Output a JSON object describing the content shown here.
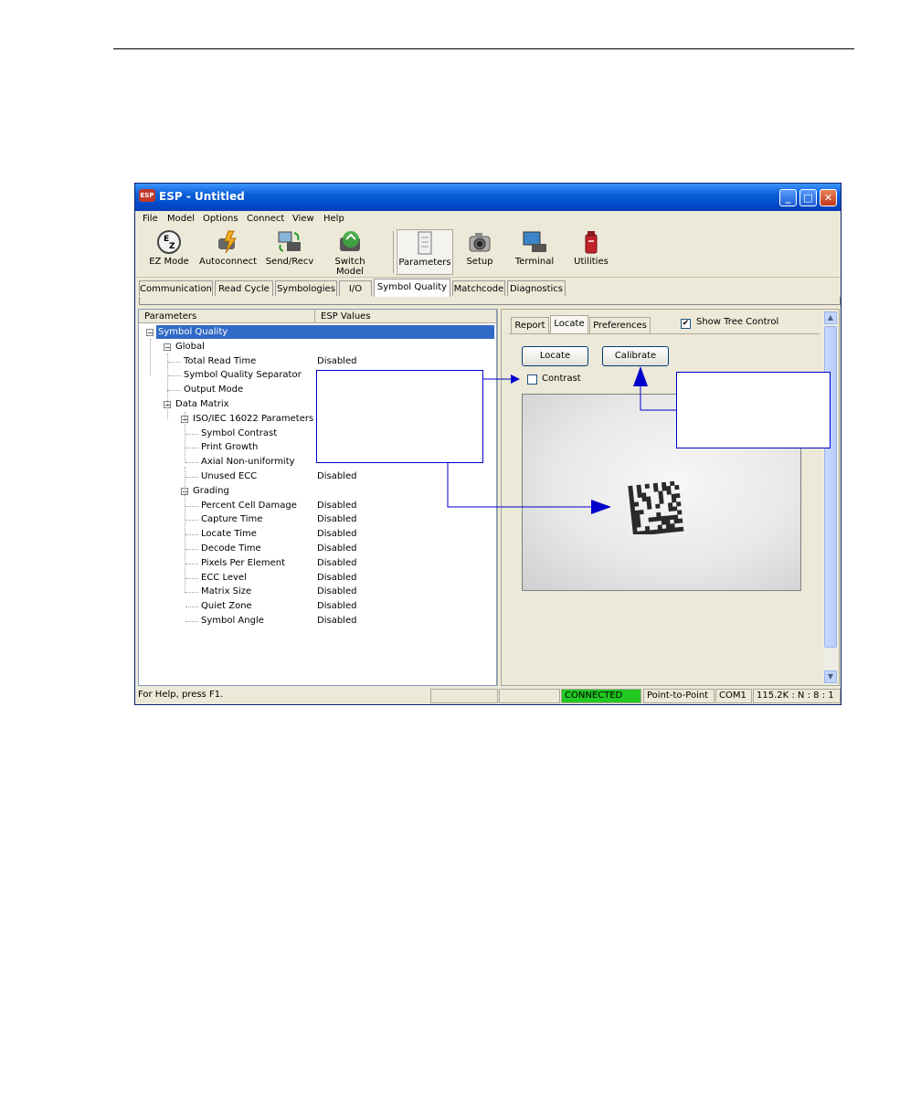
{
  "window": {
    "title": "ESP - Untitled",
    "icon_text": "ESP",
    "buttons": [
      "minimize-icon",
      "maximize-icon",
      "close-icon"
    ]
  },
  "menu": [
    "File",
    "Model",
    "Options",
    "Connect",
    "View",
    "Help"
  ],
  "toolbar": [
    {
      "label": "EZ Mode",
      "icon": "ez-mode-icon"
    },
    {
      "label": "Autoconnect",
      "icon": "autoconnect-icon"
    },
    {
      "label": "Send/Recv",
      "icon": "send-recv-icon"
    },
    {
      "label": "Switch Model",
      "icon": "switch-model-icon"
    },
    {
      "label": "Parameters",
      "icon": "parameters-icon",
      "active": true
    },
    {
      "label": "Setup",
      "icon": "camera-setup-icon"
    },
    {
      "label": "Terminal",
      "icon": "terminal-icon"
    },
    {
      "label": "Utilities",
      "icon": "utilities-icon"
    }
  ],
  "tabs": [
    "Communication",
    "Read Cycle",
    "Symbologies",
    "I/O",
    "Symbol Quality",
    "Matchcode",
    "Diagnostics"
  ],
  "active_tab": "Symbol Quality",
  "tree": {
    "columns": [
      "Parameters",
      "ESP Values"
    ],
    "rows": [
      {
        "label": "Symbol Quality",
        "value": "",
        "level": 0,
        "expander": "−",
        "selected": true
      },
      {
        "label": "Global",
        "value": "",
        "level": 1,
        "expander": "−"
      },
      {
        "label": "Total Read Time",
        "value": "Disabled",
        "level": 2
      },
      {
        "label": "Symbol Quality Separator",
        "value": "",
        "level": 2
      },
      {
        "label": "Output Mode",
        "value": "",
        "level": 2
      },
      {
        "label": "Data Matrix",
        "value": "",
        "level": 1,
        "expander": "−"
      },
      {
        "label": "ISO/IEC 16022 Parameters",
        "value": "",
        "level": 2,
        "expander": "−"
      },
      {
        "label": "Symbol Contrast",
        "value": "",
        "level": 3
      },
      {
        "label": "Print Growth",
        "value": "",
        "level": 3
      },
      {
        "label": "Axial Non-uniformity",
        "value": "",
        "level": 3
      },
      {
        "label": "Unused ECC",
        "value": "Disabled",
        "level": 3
      },
      {
        "label": "Grading",
        "value": "",
        "level": 2,
        "expander": "−"
      },
      {
        "label": "Percent Cell Damage",
        "value": "Disabled",
        "level": 3
      },
      {
        "label": "Capture Time",
        "value": "Disabled",
        "level": 3
      },
      {
        "label": "Locate Time",
        "value": "Disabled",
        "level": 3
      },
      {
        "label": "Decode Time",
        "value": "Disabled",
        "level": 3
      },
      {
        "label": "Pixels Per Element",
        "value": "Disabled",
        "level": 3
      },
      {
        "label": "ECC Level",
        "value": "Disabled",
        "level": 3
      },
      {
        "label": "Matrix Size",
        "value": "Disabled",
        "level": 3
      },
      {
        "label": "Quiet Zone",
        "value": "Disabled",
        "level": 3
      },
      {
        "label": "Symbol Angle",
        "value": "Disabled",
        "level": 3
      }
    ]
  },
  "right_panel": {
    "subtabs": [
      "Report",
      "Locate",
      "Preferences"
    ],
    "active_subtab": "Locate",
    "show_tree_control_label": "Show Tree Control",
    "show_tree_control_checked": true,
    "locate_button": "Locate",
    "calibrate_button": "Calibrate",
    "contrast_label": "Contrast",
    "contrast_checked": false
  },
  "status": {
    "help": "For Help, press F1.",
    "connection": "CONNECTED",
    "mode": "Point-to-Point",
    "port": "COM1",
    "settings": "115.2K : N : 8 : 1",
    "connected_color": "#21c821"
  },
  "annotation_color": "#0000cc"
}
